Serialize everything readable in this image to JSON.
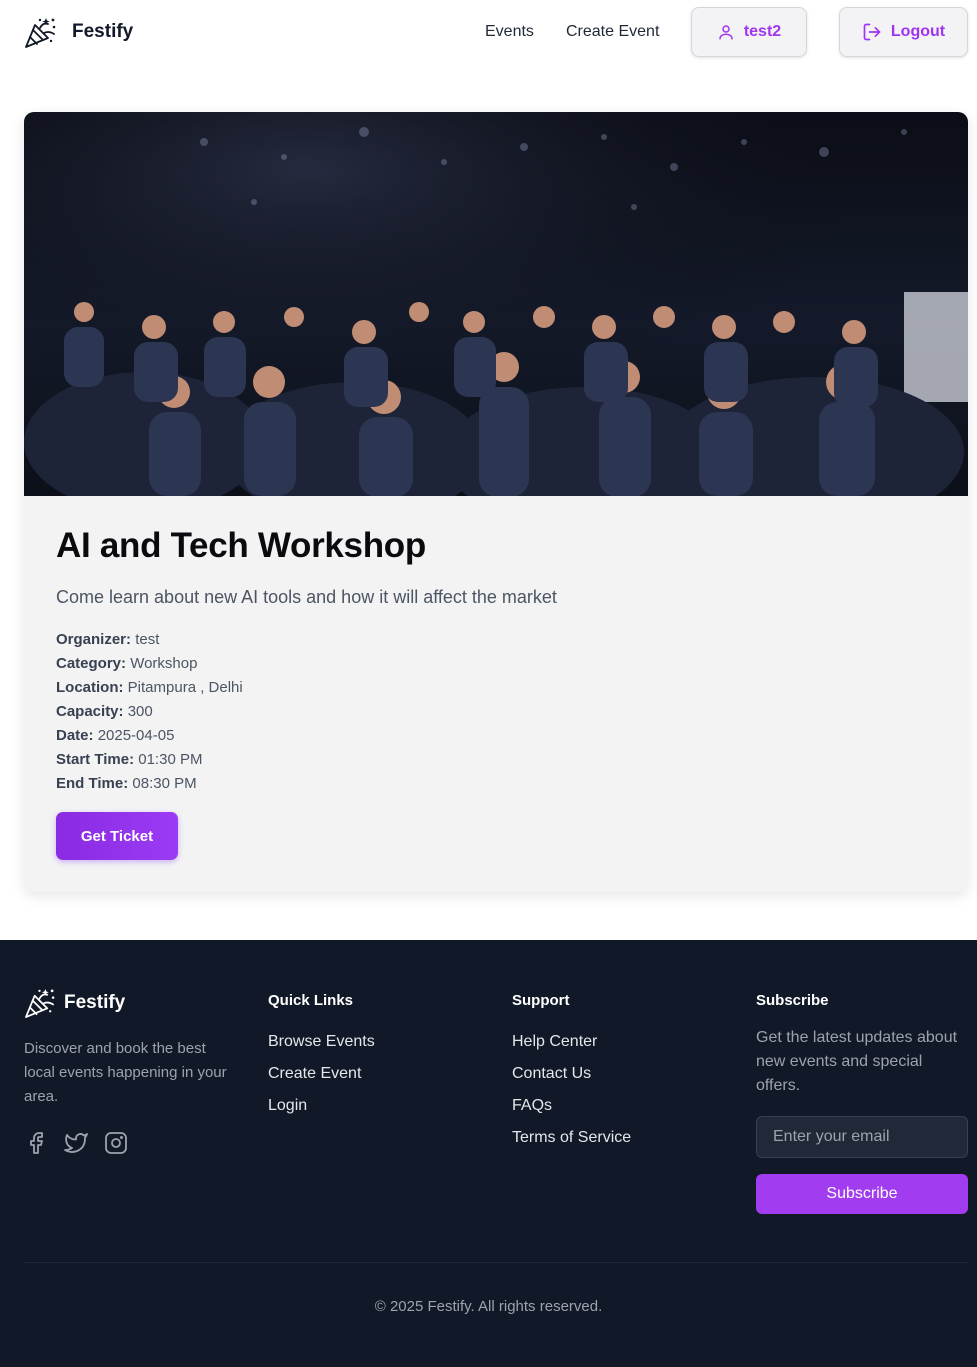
{
  "header": {
    "brand": "Festify",
    "nav": {
      "events": "Events",
      "create_event": "Create Event"
    },
    "user_button": "test2",
    "logout_button": "Logout"
  },
  "event": {
    "title": "AI and Tech Workshop",
    "description": "Come learn about new AI tools and how it will affect the market",
    "details": [
      {
        "label": "Organizer:",
        "value": "test"
      },
      {
        "label": "Category:",
        "value": "Workshop"
      },
      {
        "label": "Location:",
        "value": "Pitampura , Delhi"
      },
      {
        "label": "Capacity:",
        "value": "300"
      },
      {
        "label": "Date:",
        "value": "2025-04-05"
      },
      {
        "label": "Start Time:",
        "value": "01:30 PM"
      },
      {
        "label": "End Time:",
        "value": "08:30 PM"
      }
    ],
    "ticket_button": "Get Ticket"
  },
  "footer": {
    "brand": "Festify",
    "about": "Discover and book the best local events happening in your area.",
    "social_icons": [
      "facebook-icon",
      "twitter-icon",
      "instagram-icon"
    ],
    "quick_links": {
      "title": "Quick Links",
      "items": [
        "Browse Events",
        "Create Event",
        "Login"
      ]
    },
    "support": {
      "title": "Support",
      "items": [
        "Help Center",
        "Contact Us",
        "FAQs",
        "Terms of Service"
      ]
    },
    "subscribe": {
      "title": "Subscribe",
      "text": "Get the latest updates about new events and special offers.",
      "placeholder": "Enter your email",
      "button": "Subscribe"
    },
    "copyright": "© 2025 Festify. All rights reserved."
  },
  "colors": {
    "accent": "#a034f0",
    "footer_bg": "#111827",
    "card_bg": "#f3f3f4"
  }
}
